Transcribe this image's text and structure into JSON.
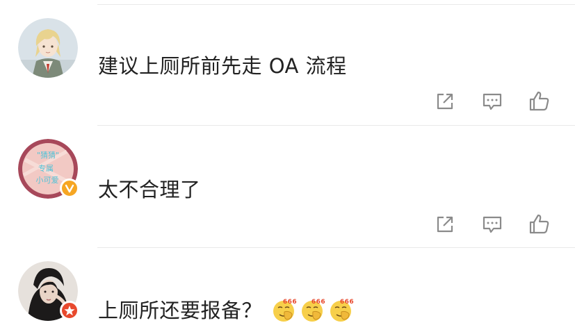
{
  "comments": [
    {
      "text": "建议上厕所前先走 OA 流程",
      "avatar_icon": "anime-character-avatar",
      "actions": [
        "share-icon",
        "comment-icon",
        "like-icon"
      ]
    },
    {
      "text": "太不合理了",
      "avatar_icon": "pink-sticker-avatar",
      "avatar_sticker_text": [
        "\"猜猜\"",
        "专属",
        "小可爱"
      ],
      "badge": "verified-yellow-v",
      "actions": [
        "share-icon",
        "comment-icon",
        "like-icon"
      ]
    },
    {
      "text": "上厕所还要报备？",
      "avatar_icon": "portrait-photo-avatar",
      "badge": "red-star-badge",
      "emojis": [
        {
          "icon": "666-emoji",
          "label": "666"
        },
        {
          "icon": "666-emoji",
          "label": "666"
        },
        {
          "icon": "666-emoji",
          "label": "666"
        }
      ]
    }
  ],
  "colors": {
    "text": "#222222",
    "icon": "#8a8a8a",
    "divider": "#e9e9e9",
    "verified": "#f6a623",
    "star_badge": "#e8492d"
  }
}
